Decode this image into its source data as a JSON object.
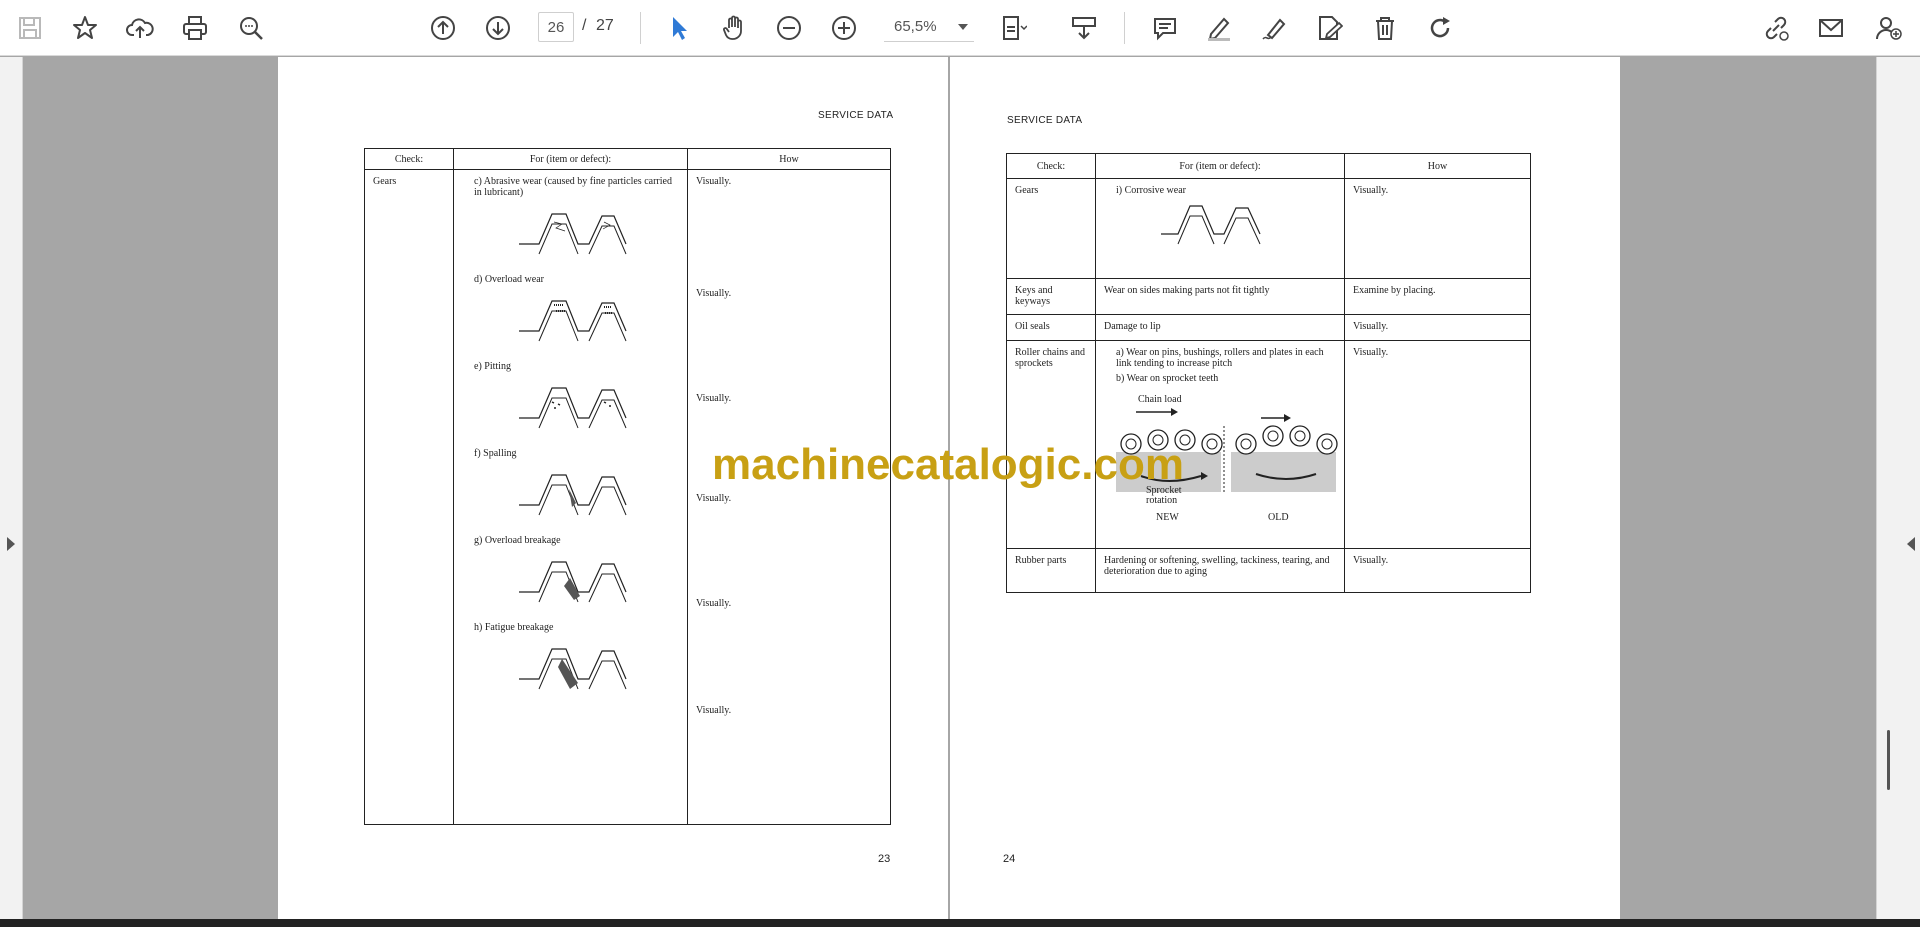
{
  "toolbar": {
    "page_current": "26",
    "page_separator": "/",
    "page_total": "27",
    "zoom": "65,5%",
    "icons": [
      "save-icon",
      "bookmark-star-icon",
      "upload-cloud-icon",
      "print-icon",
      "zoom-search-icon",
      "page-up-icon",
      "page-down-icon",
      "select-cursor-icon",
      "hand-icon",
      "zoom-out-icon",
      "zoom-in-icon",
      "page-fit-icon",
      "scroll-mode-icon",
      "comment-icon",
      "highlight-pen-icon",
      "draw-icon",
      "edit-icon",
      "delete-icon",
      "rotate-icon",
      "share-link-icon",
      "email-icon",
      "add-user-icon"
    ]
  },
  "left_page": {
    "header": "SERVICE DATA",
    "columns": [
      "Check:",
      "For (item or defect):",
      "How"
    ],
    "check": "Gears",
    "items": [
      {
        "label": "c)  Abrasive wear (caused by fine particles carried in lubricant)",
        "how": "Visually."
      },
      {
        "label": "d)  Overload wear",
        "how": "Visually."
      },
      {
        "label": "e)  Pitting",
        "how": "Visually."
      },
      {
        "label": "f)  Spalling",
        "how": "Visually."
      },
      {
        "label": "g)  Overload breakage",
        "how": "Visually."
      },
      {
        "label": "h)  Fatigue breakage",
        "how": "Visually."
      }
    ],
    "page_number": "23"
  },
  "right_page": {
    "header": "SERVICE DATA",
    "columns": [
      "Check:",
      "For (item or defect):",
      "How"
    ],
    "rows": [
      {
        "check": "Gears",
        "item": "i)  Corrosive wear",
        "how": "Visually."
      },
      {
        "check": "Keys and keyways",
        "item": "Wear on sides making parts not fit tightly",
        "how": "Examine by placing."
      },
      {
        "check": "Oil seals",
        "item": "Damage to lip",
        "how": "Visually."
      },
      {
        "check": "Roller chains and sprockets",
        "item": "a)  Wear on pins, bushings, rollers and plates in each link tending to increase pitch",
        "item2": "b)  Wear on sprocket teeth",
        "how": "Visually."
      },
      {
        "check": "Rubber parts",
        "item": "Hardening or softening, swelling, tackiness, tearing, and deterioration due to aging",
        "how": "Visually."
      }
    ],
    "figure": {
      "chain_load": "Chain load",
      "sprocket_rotation": "Sprocket rotation",
      "new": "NEW",
      "old": "OLD"
    },
    "page_number": "24"
  },
  "watermark": "machinecatalogic.com"
}
